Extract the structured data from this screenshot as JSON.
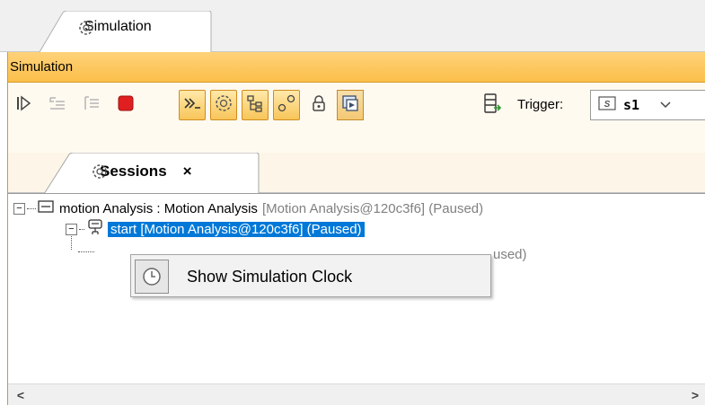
{
  "outer_tab": {
    "label": "Simulation",
    "icon": "simulation-gear-icon"
  },
  "panel": {
    "title": "Simulation"
  },
  "toolbar": {
    "buttons": [
      {
        "name": "resume-icon",
        "state": "enabled"
      },
      {
        "name": "step-into-icon",
        "state": "disabled"
      },
      {
        "name": "step-over-icon",
        "state": "disabled"
      },
      {
        "name": "terminate-icon",
        "state": "enabled",
        "color": "#e02020"
      },
      {
        "name": "console-icon",
        "state": "toggled"
      },
      {
        "name": "sessions-icon",
        "state": "toggled"
      },
      {
        "name": "variables-icon",
        "state": "toggled"
      },
      {
        "name": "breakpoints-icon",
        "state": "toggled"
      },
      {
        "name": "lock-icon",
        "state": "enabled"
      },
      {
        "name": "animation-icon",
        "state": "selected"
      },
      {
        "name": "export-trace-icon",
        "state": "enabled"
      }
    ],
    "trigger_label": "Trigger:",
    "trigger_value": "s1"
  },
  "sessions_tab": {
    "label": "Sessions",
    "close": "×"
  },
  "tree": {
    "root": {
      "name": "motion Analysis : Motion Analysis",
      "suffix": "[Motion Analysis@120c3f6] (Paused)"
    },
    "child": {
      "label": "start [Motion Analysis@120c3f6] (Paused)"
    },
    "grandchild_partial": "used)"
  },
  "context_menu": {
    "items": [
      {
        "label": "Show Simulation Clock",
        "icon": "clock-icon"
      }
    ]
  },
  "scrollbar": {
    "left": "<",
    "right": ">"
  },
  "colors": {
    "panel_title": "#fbbf4a",
    "selection": "#0078d7",
    "toggle_border": "#d28c1d"
  }
}
